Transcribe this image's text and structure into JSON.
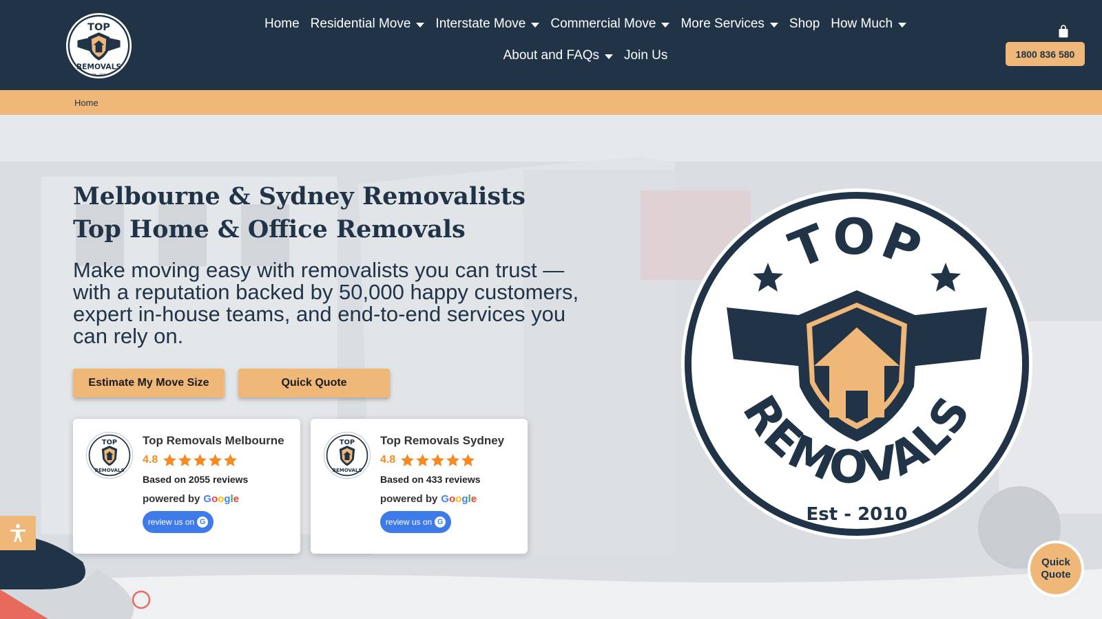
{
  "brand": {
    "logo_top": "TOP",
    "logo_bottom": "REMOVALS",
    "logo_est": "Est - 2010",
    "logo_est_small": "Est - 2010",
    "colors": {
      "navy": "#213347",
      "orange": "#f0b878",
      "star": "#f58a23"
    }
  },
  "nav": {
    "row1": [
      {
        "label": "Home",
        "dropdown": false
      },
      {
        "label": "Residential Move",
        "dropdown": true
      },
      {
        "label": "Interstate Move",
        "dropdown": true
      },
      {
        "label": "Commercial Move",
        "dropdown": true
      },
      {
        "label": "More Services",
        "dropdown": true
      },
      {
        "label": "Shop",
        "dropdown": false
      },
      {
        "label": "How Much",
        "dropdown": true
      }
    ],
    "row2": [
      {
        "label": "About and FAQs",
        "dropdown": true
      },
      {
        "label": "Join Us",
        "dropdown": false
      }
    ],
    "phone": "1800 836 580",
    "cart_icon": "shopping-bag-icon"
  },
  "breadcrumb": {
    "home": "Home"
  },
  "hero": {
    "title_line1": "Melbourne & Sydney Removalists",
    "title_line2": "Top Home & Office Removals",
    "lead": "Make moving easy with removalists you can trust — with a reputation backed by 50,000 happy customers, expert in-house teams, and end-to-end services you can rely on.",
    "btn_estimate": "Estimate My Move Size",
    "btn_quote": "Quick Quote"
  },
  "reviews": [
    {
      "name": "Top Removals Melbourne",
      "rating": "4.8",
      "stars": 5,
      "reviews": "Based on 2055 reviews",
      "powered": "powered by",
      "cta": "review us on"
    },
    {
      "name": "Top Removals Sydney",
      "rating": "4.8",
      "stars": 5,
      "reviews": "Based on 433 reviews",
      "powered": "powered by",
      "cta": "review us on"
    }
  ],
  "google_word": "Google",
  "fab": {
    "line1": "Quick",
    "line2": "Quote"
  },
  "accessibility_icon": "accessibility-icon"
}
